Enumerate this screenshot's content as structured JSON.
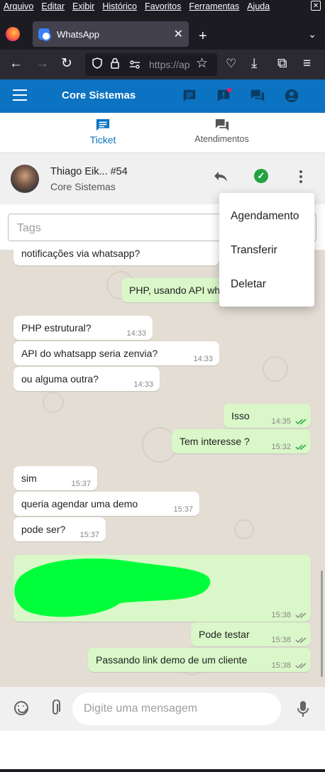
{
  "browser": {
    "menu": [
      "Arquivo",
      "Editar",
      "Exibir",
      "Histórico",
      "Favoritos",
      "Ferramentas",
      "Ajuda"
    ],
    "close_glyph": "✕",
    "tab_title": "WhatsApp",
    "tab_close": "✕",
    "new_tab": "+",
    "tab_list": "⌄",
    "url": "https://ap",
    "nav": {
      "back": "←",
      "forward": "→",
      "reload": "↻",
      "star": "☆",
      "pocket": "♡",
      "download": "⤓",
      "extensions": "⧉",
      "menu": "≡"
    }
  },
  "header": {
    "title": "Core Sistemas",
    "icons": [
      "message-icon",
      "alert-message-icon",
      "forum-icon",
      "account-icon"
    ],
    "notification_color": "#e91e63",
    "brand_color": "#0b73c2"
  },
  "tabs": [
    {
      "label": "Ticket",
      "icon": "ticket-icon",
      "active": true
    },
    {
      "label": "Atendimentos",
      "icon": "atendimentos-icon",
      "active": false
    }
  ],
  "ticket": {
    "name": "Thiago Eik... #54",
    "company": "Core Sistemas",
    "resolve_icon": "✓",
    "resolve_color": "#23a243"
  },
  "tags": {
    "placeholder": "Tags"
  },
  "menu": {
    "items": [
      "Agendamento",
      "Transferir",
      "Deletar"
    ]
  },
  "messages": [
    {
      "dir": "in",
      "text": "notificações via whatsapp?",
      "time": ""
    },
    {
      "dir": "out",
      "text": "PHP, usando API wh",
      "time": ""
    },
    {
      "dir": "in",
      "text": "PHP estrutural?",
      "time": "14:33"
    },
    {
      "dir": "in",
      "text": "API do whatsapp seria zenvia?",
      "time": "14:33"
    },
    {
      "dir": "in",
      "text": "ou alguma outra?",
      "time": "14:33"
    },
    {
      "dir": "out",
      "text": "Isso",
      "time": "14:35"
    },
    {
      "dir": "out",
      "text": "Tem interesse ?",
      "time": "15:32"
    },
    {
      "dir": "in",
      "text": "sim",
      "time": "15:37"
    },
    {
      "dir": "in",
      "text": "queria agendar uma demo",
      "time": "15:37"
    },
    {
      "dir": "in",
      "text": "pode ser?",
      "time": "15:37"
    },
    {
      "dir": "out",
      "text": "",
      "time": "15:38",
      "redacted": true
    },
    {
      "dir": "out",
      "text": "Pode testar",
      "time": "15:38"
    },
    {
      "dir": "out",
      "text": "Passando link demo de um cliente",
      "time": "15:38"
    }
  ],
  "input": {
    "placeholder": "Digite uma mensagem"
  },
  "colors": {
    "check_read": "#25a643",
    "check_sent": "#8a8a8a",
    "redaction": "#00ff3a"
  }
}
